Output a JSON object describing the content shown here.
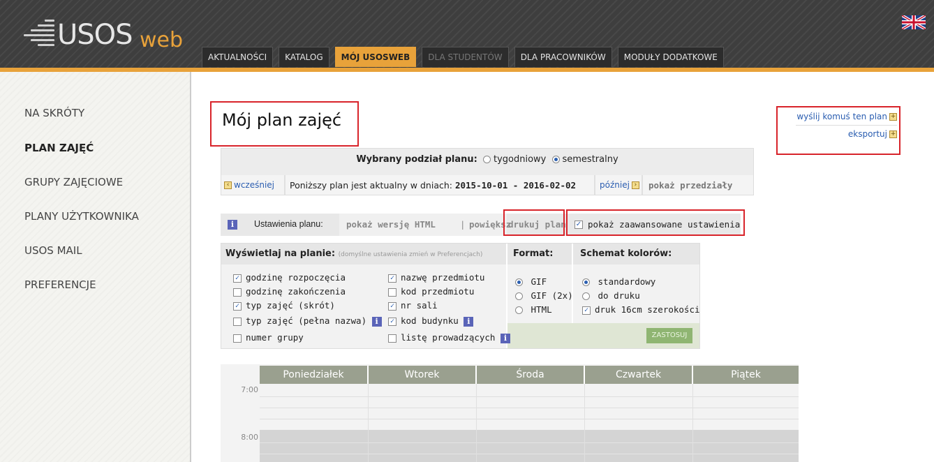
{
  "header": {
    "logo_text": "USOS",
    "logo_suffix": "web",
    "tabs": [
      {
        "label": "AKTUALNOŚCI",
        "state": "normal"
      },
      {
        "label": "KATALOG",
        "state": "normal"
      },
      {
        "label": "MÓJ USOSWEB",
        "state": "active"
      },
      {
        "label": "DLA STUDENTÓW",
        "state": "disabled"
      },
      {
        "label": "DLA PRACOWNIKÓW",
        "state": "normal"
      },
      {
        "label": "MODUŁY DODATKOWE",
        "state": "normal"
      }
    ],
    "accent_color": "#e8a23a"
  },
  "sidebar": {
    "items": [
      {
        "label": "NA SKRÓTY"
      },
      {
        "label": "PLAN ZAJĘĆ",
        "active": true
      },
      {
        "label": "GRUPY ZAJĘCIOWE"
      },
      {
        "label": "PLANY UŻYTKOWNIKA"
      },
      {
        "label": "USOS MAIL"
      },
      {
        "label": "PREFERENCJE"
      }
    ]
  },
  "main": {
    "title": "Mój plan zajęć",
    "side_links": {
      "send": "wyślij komuś ten plan",
      "export": "eksportuj"
    },
    "period": {
      "label": "Wybrany podział planu:",
      "option_weekly": "tygodniowy",
      "option_semester": "semestralny",
      "earlier": "wcześniej",
      "valid_label": "Poniższy plan jest aktualny w dniach:",
      "range": "2015-10-01 - 2016-02-02",
      "later": "później",
      "show_ranges": "pokaż przedziały"
    },
    "settings": {
      "label": "Ustawienia planu:",
      "html_version": "pokaż wersję HTML",
      "separator": "|",
      "enlarge": "powiększ",
      "print": "drukuj plan",
      "advanced": "pokaż zaawansowane ustawienia"
    },
    "options": {
      "display_head": "Wyświetlaj na planie:",
      "display_note": "(domyślne ustawienia zmień w Preferencjach)",
      "format_head": "Format:",
      "colors_head": "Schemat kolorów:",
      "col1": [
        "godzinę rozpoczęcia",
        "godzinę zakończenia",
        "typ zajęć (skrót)",
        "typ zajęć (pełna nazwa)",
        "numer grupy"
      ],
      "col2": [
        "nazwę przedmiotu",
        "kod przedmiotu",
        "nr sali",
        "kod budynku",
        "listę prowadzących"
      ],
      "formats": [
        "GIF",
        "GIF (2x)",
        "HTML"
      ],
      "colors": [
        "standardowy",
        "do druku",
        "druk 16cm szerokości"
      ],
      "apply": "ZASTOSUJ"
    },
    "timetable": {
      "days": [
        "Poniedziałek",
        "Wtorek",
        "Środa",
        "Czwartek",
        "Piątek"
      ],
      "hours": [
        "7:00",
        "8:00"
      ]
    }
  }
}
